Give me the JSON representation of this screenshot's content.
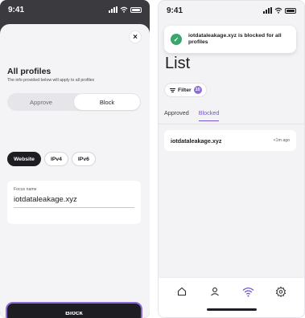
{
  "left_screen": {
    "status_time": "9:41",
    "close_glyph": "×",
    "title": "All profiles",
    "subtitle": "The info provided below will apply to all profiles",
    "segment": {
      "options": [
        "Approve",
        "Block"
      ],
      "selected": "Block"
    },
    "chips": [
      {
        "label": "Website",
        "selected": true
      },
      {
        "label": "IPv4",
        "selected": false
      },
      {
        "label": "IPv6",
        "selected": false
      }
    ],
    "field": {
      "label": "Focus name",
      "value": "iotdataleakage.xyz"
    },
    "primary_button": "Block"
  },
  "right_screen": {
    "status_time": "9:41",
    "toast": {
      "message": "iotdataleakage.xyz is blocked for all profiles",
      "icon": "check-circle-icon"
    },
    "title": "List",
    "filter": {
      "label": "Filter",
      "count": "10"
    },
    "tabs": [
      {
        "label": "Approved",
        "active": false
      },
      {
        "label": "Blocked",
        "active": true
      }
    ],
    "rows": [
      {
        "name": "iotdataleakage.xyz",
        "time": "<1m ago"
      }
    ],
    "tabbar": [
      "home-icon",
      "profile-icon",
      "wifi-icon",
      "settings-icon"
    ]
  },
  "colors": {
    "accent": "#7456c9",
    "accent_glow": "#8d6bd9",
    "primary_dark": "#1d1d22",
    "success": "#3aa66b"
  }
}
